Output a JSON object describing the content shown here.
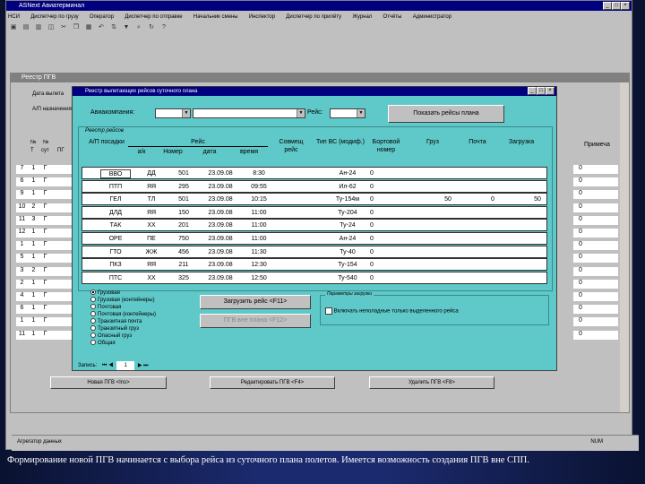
{
  "app": {
    "title": "ASNext Авиатерминал"
  },
  "menu": [
    "НСИ",
    "Диспетчер по грузу",
    "Оператор",
    "Диспетчер по отправке",
    "Начальник смены",
    "Инспектор",
    "Диспетчер по прилёту",
    "Журнал",
    "Отчёты",
    "Администратор"
  ],
  "back": {
    "title": "Реестр ПГВ",
    "labels": {
      "date": "Дата вылета",
      "ap": "А/П назначения"
    },
    "cols": {
      "c1": "№",
      "c2": "№",
      "c3": "Т",
      "c4": "сут",
      "c5": "ПГ",
      "right": "Примеча"
    },
    "rows": [
      {
        "a": "7",
        "b": "1",
        "c": "Г"
      },
      {
        "a": "6",
        "b": "1",
        "c": "Г"
      },
      {
        "a": "9",
        "b": "1",
        "c": "Г"
      },
      {
        "a": "10",
        "b": "2",
        "c": "Г"
      },
      {
        "a": "11",
        "b": "3",
        "c": "Г"
      },
      {
        "a": "12",
        "b": "1",
        "c": "Г"
      },
      {
        "a": "1",
        "b": "1",
        "c": "Г"
      },
      {
        "a": "5",
        "b": "1",
        "c": "Г"
      },
      {
        "a": "3",
        "b": "2",
        "c": "Г"
      },
      {
        "a": "2",
        "b": "1",
        "c": "Г"
      },
      {
        "a": "4",
        "b": "1",
        "c": "Г"
      },
      {
        "a": "6",
        "b": "1",
        "c": "Г"
      },
      {
        "a": "1",
        "b": "1",
        "c": "Г"
      },
      {
        "a": "11",
        "b": "1",
        "c": "Г"
      }
    ],
    "right_values": [
      "0",
      "0",
      "0",
      "0",
      "0",
      "0",
      "0",
      "0",
      "0",
      "0",
      "0",
      "0",
      "0",
      "0"
    ],
    "buttons": {
      "new": "Новая ПГВ <Ins>",
      "edit": "Редактировать ПГВ <F4>",
      "delete": "Удалить ПГВ <F8>"
    }
  },
  "dialog": {
    "title": "Реестр вылетающих рейсов суточного плана",
    "airline_label": "Авиакомпания:",
    "flight_label": "Рейс:",
    "show_button": "Показать рейсы плана",
    "grid_caption": "Реестр рейсов",
    "headers": {
      "ap": "А/П посадки",
      "flight": "Рейс",
      "ak": "а/к",
      "num": "Номер",
      "date": "дата",
      "time": "время",
      "combined": "Совмещ рейс",
      "vs": "Тип ВС (модиф.)",
      "board": "Бортовой номер",
      "cargo": "Груз",
      "mail": "Почта",
      "load": "Загрузка"
    },
    "flights": [
      {
        "ap": "ВВО",
        "ak": "ДД",
        "num": "501",
        "date": "23.09.08",
        "time": "8:30",
        "vs": "Ан-24",
        "board": "0",
        "cargo": "",
        "mail": "",
        "load": ""
      },
      {
        "ap": "ПТП",
        "ak": "ЯЯ",
        "num": "295",
        "date": "23.09.08",
        "time": "09:55",
        "vs": "Ил-62",
        "board": "0",
        "cargo": "",
        "mail": "",
        "load": ""
      },
      {
        "ap": "ГЕЛ",
        "ak": "ТЛ",
        "num": "501",
        "date": "23.09.08",
        "time": "10:15",
        "vs": "Ту-154м",
        "board": "0",
        "cargo": "50",
        "mail": "0",
        "load": "50"
      },
      {
        "ap": "ДЛД",
        "ak": "ЯЯ",
        "num": "150",
        "date": "23.09.08",
        "time": "11:00",
        "vs": "Ту-204",
        "board": "0",
        "cargo": "",
        "mail": "",
        "load": ""
      },
      {
        "ap": "ТАК",
        "ak": "ХХ",
        "num": "201",
        "date": "23.09.08",
        "time": "11:00",
        "vs": "Ту-24",
        "board": "0",
        "cargo": "",
        "mail": "",
        "load": ""
      },
      {
        "ap": "ОРЕ",
        "ak": "ПЕ",
        "num": "750",
        "date": "23.09.08",
        "time": "11:00",
        "vs": "Ан-24",
        "board": "0",
        "cargo": "",
        "mail": "",
        "load": ""
      },
      {
        "ap": "ГТО",
        "ak": "ЖЖ",
        "num": "456",
        "date": "23.09.08",
        "time": "11:30",
        "vs": "Ту-40",
        "board": "0",
        "cargo": "",
        "mail": "",
        "load": ""
      },
      {
        "ap": "ПКЗ",
        "ak": "ЯЯ",
        "num": "211",
        "date": "23.09.08",
        "time": "12:30",
        "vs": "Ту-154",
        "board": "0",
        "cargo": "",
        "mail": "",
        "load": ""
      },
      {
        "ap": "ПТС",
        "ak": "ХХ",
        "num": "325",
        "date": "23.09.08",
        "time": "12:50",
        "vs": "Ту-540",
        "board": "0",
        "cargo": "",
        "mail": "",
        "load": ""
      }
    ],
    "radios": [
      "Грузовая",
      "Грузовая (контейнеры)",
      "Почтовая",
      "Почтовая (контейнеры)",
      "Транзитная почта",
      "Транзитный груз",
      "Опасный груз",
      "Общая"
    ],
    "load_button": "Загрузить рейс <F11>",
    "outside_button": "ПГВ вне плана <F12>",
    "params_caption": "Параметры загрузки",
    "checkbox_label": "Включать неполадные только выделенного рейса",
    "record_label": "Запись:",
    "record_value": "1"
  },
  "statusbar": {
    "text": "Агрегатор данных",
    "num": "NUM"
  },
  "caption": "Формирование новой ПГВ начинается с выбора рейса из суточного плана полетов. Имеется возможность создания ПГВ вне СПП."
}
